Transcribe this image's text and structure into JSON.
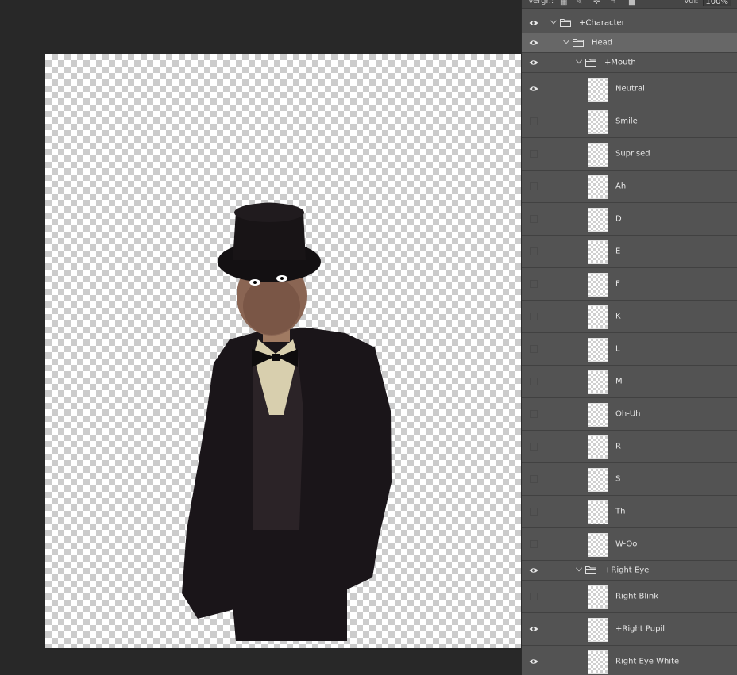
{
  "toolbar": {
    "lock_label": "Vergr.:",
    "opacity_label": "Vul:",
    "opacity_value": "100%"
  },
  "layers": [
    {
      "name": "+Character",
      "type": "group",
      "visible": true,
      "depth": 0,
      "selected": false
    },
    {
      "name": "Head",
      "type": "group",
      "visible": true,
      "depth": 1,
      "selected": true
    },
    {
      "name": "+Mouth",
      "type": "group",
      "visible": true,
      "depth": 2,
      "selected": false
    },
    {
      "name": "Neutral",
      "type": "layer",
      "visible": true,
      "selected": false
    },
    {
      "name": "Smile",
      "type": "layer",
      "visible": false,
      "selected": false
    },
    {
      "name": "Suprised",
      "type": "layer",
      "visible": false,
      "selected": false
    },
    {
      "name": "Ah",
      "type": "layer",
      "visible": false,
      "selected": false
    },
    {
      "name": "D",
      "type": "layer",
      "visible": false,
      "selected": false
    },
    {
      "name": "E",
      "type": "layer",
      "visible": false,
      "selected": false
    },
    {
      "name": "F",
      "type": "layer",
      "visible": false,
      "selected": false
    },
    {
      "name": "K",
      "type": "layer",
      "visible": false,
      "selected": false
    },
    {
      "name": "L",
      "type": "layer",
      "visible": false,
      "selected": false
    },
    {
      "name": "M",
      "type": "layer",
      "visible": false,
      "selected": false
    },
    {
      "name": "Oh-Uh",
      "type": "layer",
      "visible": false,
      "selected": false
    },
    {
      "name": "R",
      "type": "layer",
      "visible": false,
      "selected": false
    },
    {
      "name": "S",
      "type": "layer",
      "visible": false,
      "selected": false
    },
    {
      "name": "Th",
      "type": "layer",
      "visible": false,
      "selected": false
    },
    {
      "name": "W-Oo",
      "type": "layer",
      "visible": false,
      "selected": false
    },
    {
      "name": "+Right Eye",
      "type": "group",
      "visible": true,
      "depth": 2,
      "selected": false
    },
    {
      "name": "Right Blink",
      "type": "layer",
      "visible": false,
      "selected": false
    },
    {
      "name": "+Right Pupil",
      "type": "layer",
      "visible": true,
      "selected": false
    },
    {
      "name": "Right Eye White",
      "type": "layer",
      "visible": true,
      "selected": false
    }
  ]
}
